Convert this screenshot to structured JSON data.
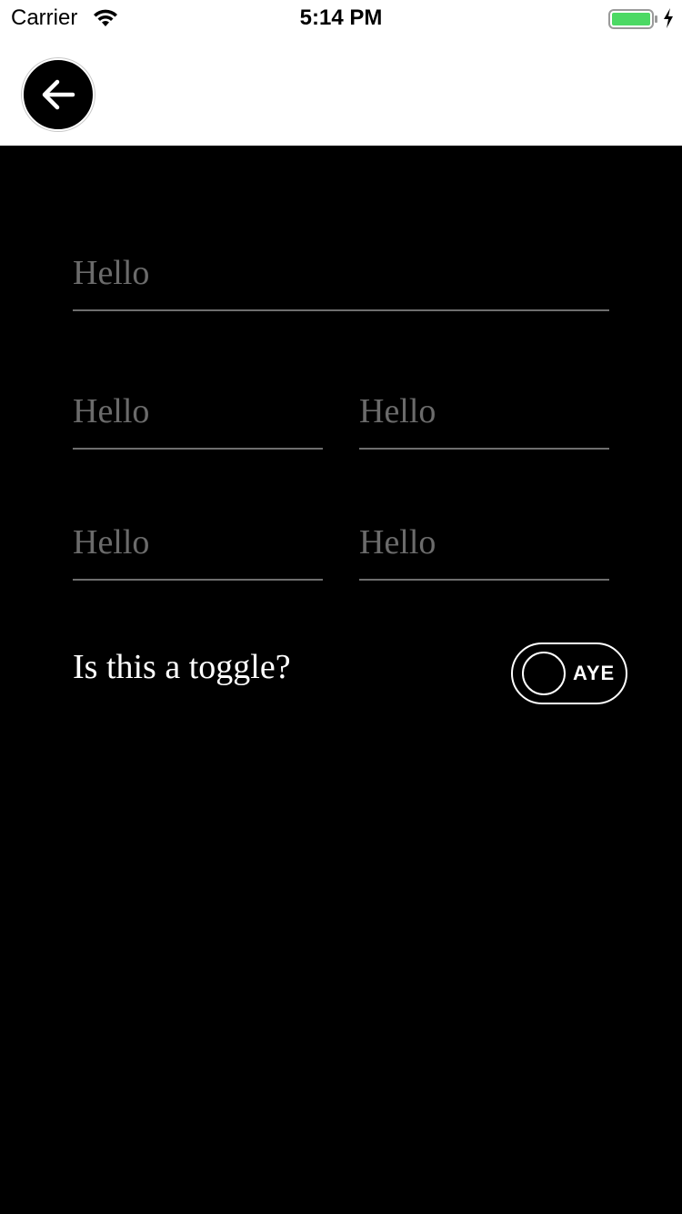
{
  "status_bar": {
    "carrier": "Carrier",
    "time": "5:14 PM",
    "wifi_icon": "wifi-icon",
    "battery_icon": "battery-icon",
    "charging_icon": "charging-bolt-icon",
    "battery_color": "#4cd964"
  },
  "nav": {
    "back_icon": "arrow-left-icon"
  },
  "form": {
    "fields": [
      {
        "placeholder": "Hello",
        "value": ""
      },
      {
        "placeholder": "Hello",
        "value": ""
      },
      {
        "placeholder": "Hello",
        "value": ""
      },
      {
        "placeholder": "Hello",
        "value": ""
      },
      {
        "placeholder": "Hello",
        "value": ""
      }
    ],
    "toggle_label": "Is this a toggle?",
    "toggle_text": "AYE"
  }
}
